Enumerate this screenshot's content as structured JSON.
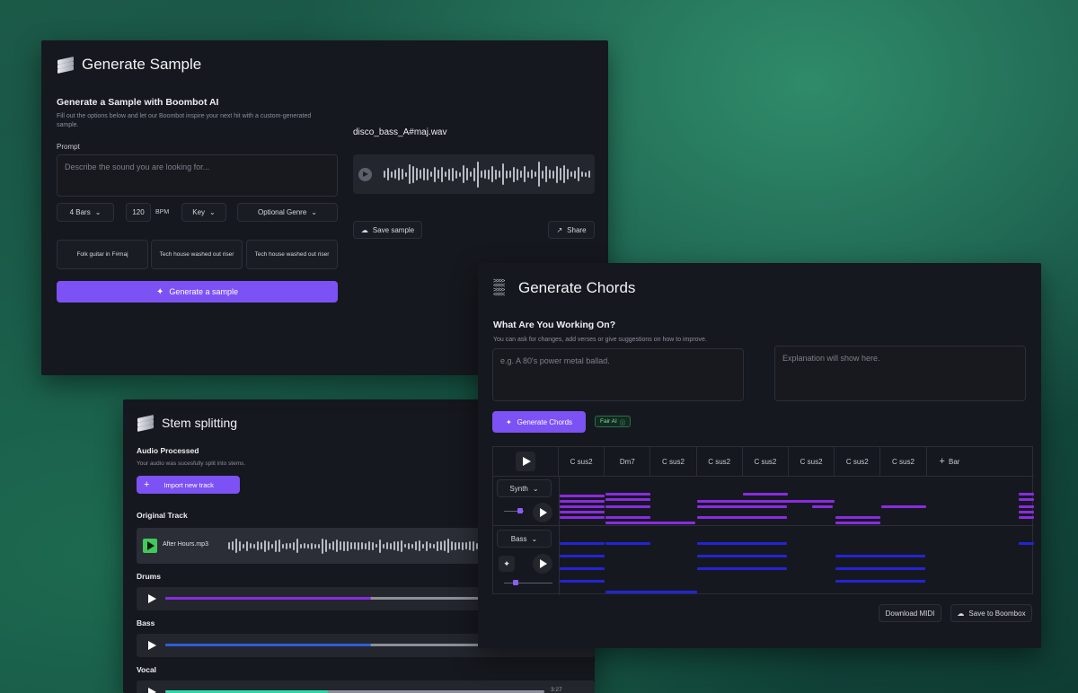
{
  "sample": {
    "title": "Generate Sample",
    "heading": "Generate a Sample with Boombot AI",
    "description": "Fill out the options below and let our Boombot inspire your next hit with a custom-generated sample.",
    "prompt_label": "Prompt",
    "prompt_placeholder": "Describe the sound you are looking for...",
    "bars": "4 Bars",
    "bpm_value": "120",
    "bpm_label": "BPM",
    "key": "Key",
    "genre": "Optional Genre",
    "suggestions": [
      "Folk guitar  in F#maj",
      "Tech house washed out riser",
      "Tech house washed out riser"
    ],
    "generate_label": "Generate a sample",
    "file_name": "disco_bass_A#maj.wav",
    "save_label": "Save sample",
    "share_label": "Share"
  },
  "chords": {
    "title": "Generate Chords",
    "heading": "What Are You Working On?",
    "description": "You can ask for changes, add verses or give suggestions on how to improve.",
    "input_placeholder": "e.g. A 80's power metal ballad.",
    "explanation_placeholder": "Explanation will show here.",
    "generate_label": "Generate Chords",
    "fair_label": "Fair AI",
    "bars": [
      "C sus2",
      "Dm7",
      "C sus2",
      "C sus2",
      "C sus2",
      "C sus2",
      "C sus2",
      "C sus2"
    ],
    "add_bar": "Bar",
    "tracks": [
      "Synth",
      "Bass"
    ],
    "download_label": "Download MIDI",
    "save_label": "Save to Boombox",
    "colors": {
      "synth": "#8a2be2",
      "bass": "#2424d6"
    }
  },
  "stems": {
    "title": "Stem splitting",
    "heading": "Audio Processed",
    "description": "Your audio was sucesfully split into stems.",
    "import_label": "Import  new track",
    "original_label": "Original Track",
    "original_file": "After Hours.mp3",
    "tracks": [
      {
        "name": "Drums",
        "color": "#8a2be2",
        "progress": 0.48
      },
      {
        "name": "Bass",
        "color": "#2c5fd6",
        "progress": 0.48
      },
      {
        "name": "Vocal",
        "color": "#2ed6a8",
        "progress": 0.43
      }
    ],
    "vocal_time": "3:27"
  }
}
